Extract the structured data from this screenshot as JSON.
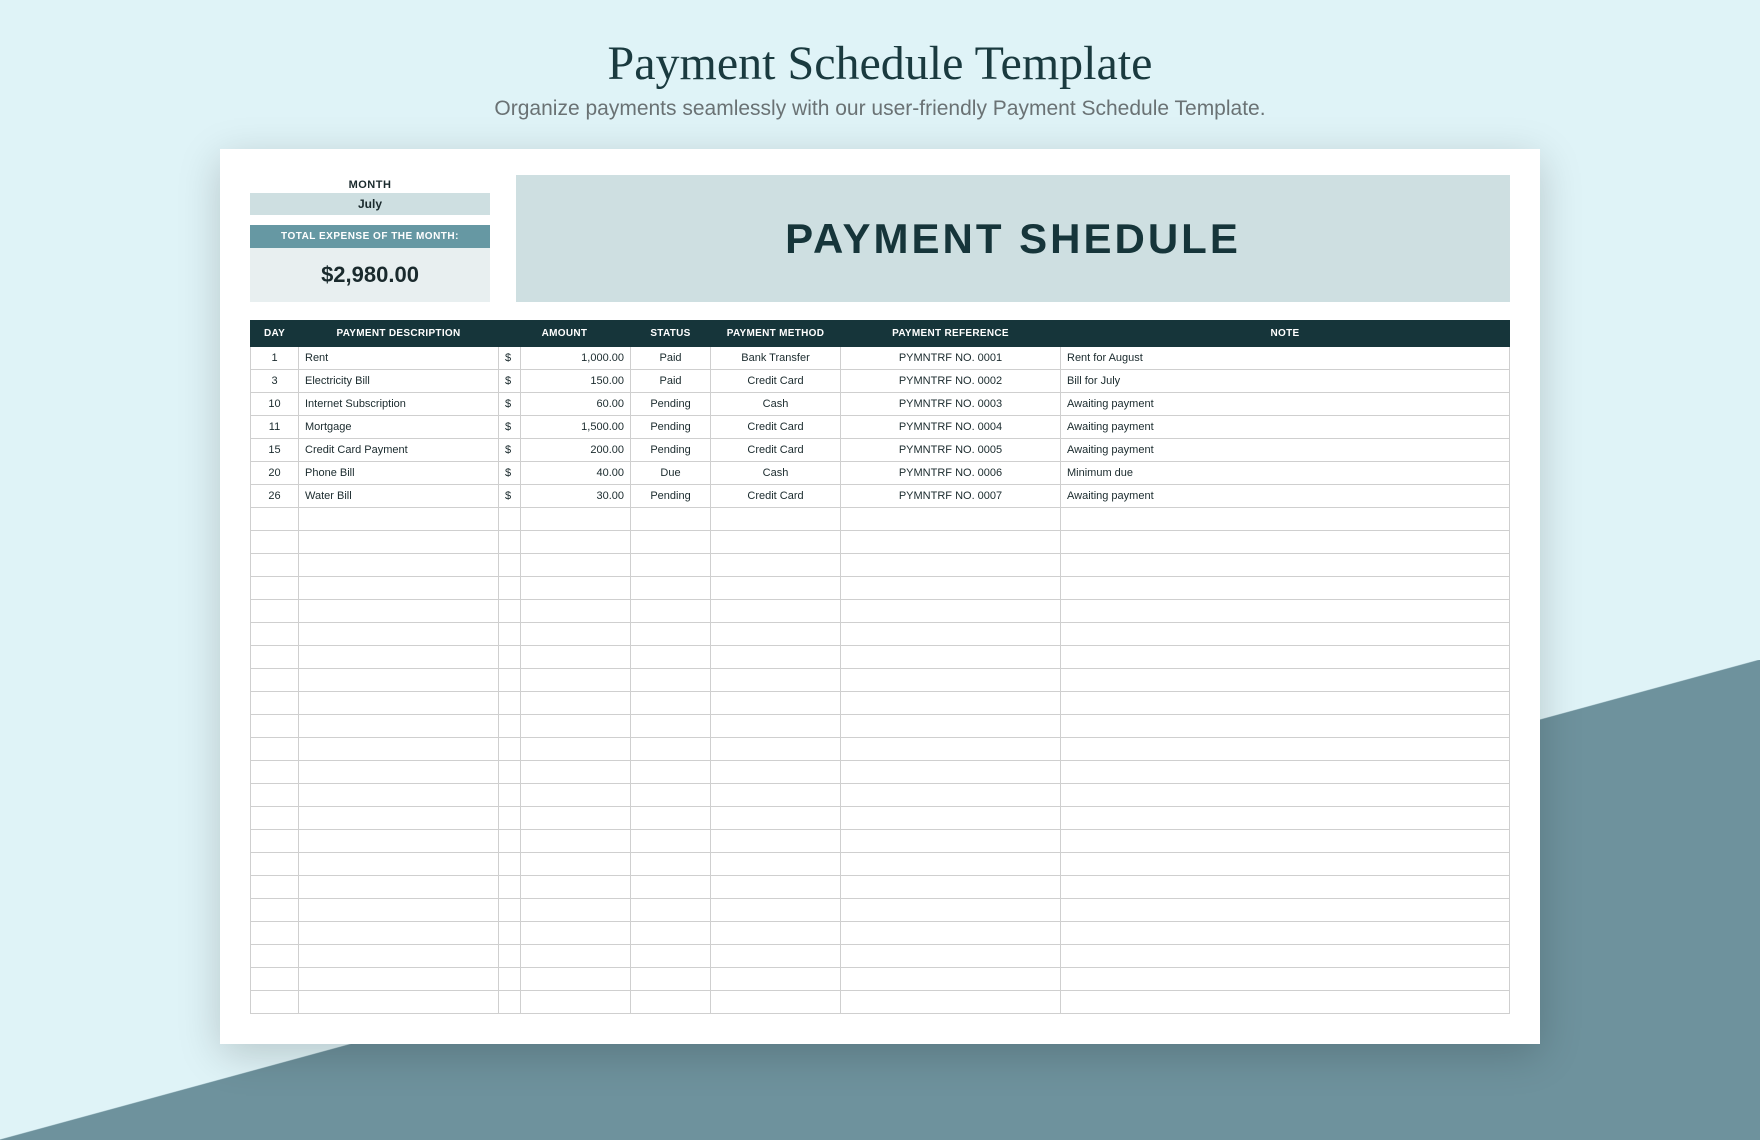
{
  "page": {
    "title": "Payment Schedule Template",
    "subtitle": "Organize payments seamlessly with our user-friendly Payment Schedule Template."
  },
  "summary": {
    "month_label": "MONTH",
    "month_value": "July",
    "total_label": "TOTAL EXPENSE OF THE MONTH:",
    "total_value": "$2,980.00"
  },
  "banner": "PAYMENT SHEDULE",
  "table": {
    "headers": {
      "day": "DAY",
      "description": "PAYMENT DESCRIPTION",
      "amount": "AMOUNT",
      "status": "STATUS",
      "method": "PAYMENT METHOD",
      "reference": "PAYMENT REFERENCE",
      "note": "NOTE"
    },
    "currency_symbol": "$",
    "rows": [
      {
        "day": "1",
        "description": "Rent",
        "amount": "1,000.00",
        "status": "Paid",
        "method": "Bank Transfer",
        "reference": "PYMNTRF NO. 0001",
        "note": "Rent for August"
      },
      {
        "day": "3",
        "description": "Electricity Bill",
        "amount": "150.00",
        "status": "Paid",
        "method": "Credit Card",
        "reference": "PYMNTRF NO. 0002",
        "note": "Bill for July"
      },
      {
        "day": "10",
        "description": "Internet Subscription",
        "amount": "60.00",
        "status": "Pending",
        "method": "Cash",
        "reference": "PYMNTRF NO. 0003",
        "note": "Awaiting payment"
      },
      {
        "day": "11",
        "description": "Mortgage",
        "amount": "1,500.00",
        "status": "Pending",
        "method": "Credit Card",
        "reference": "PYMNTRF NO. 0004",
        "note": "Awaiting payment"
      },
      {
        "day": "15",
        "description": "Credit Card Payment",
        "amount": "200.00",
        "status": "Pending",
        "method": "Credit Card",
        "reference": "PYMNTRF NO. 0005",
        "note": "Awaiting payment"
      },
      {
        "day": "20",
        "description": "Phone Bill",
        "amount": "40.00",
        "status": "Due",
        "method": "Cash",
        "reference": "PYMNTRF NO. 0006",
        "note": "Minimum due"
      },
      {
        "day": "26",
        "description": "Water Bill",
        "amount": "30.00",
        "status": "Pending",
        "method": "Credit Card",
        "reference": "PYMNTRF NO. 0007",
        "note": "Awaiting payment"
      }
    ],
    "empty_row_count": 22
  }
}
